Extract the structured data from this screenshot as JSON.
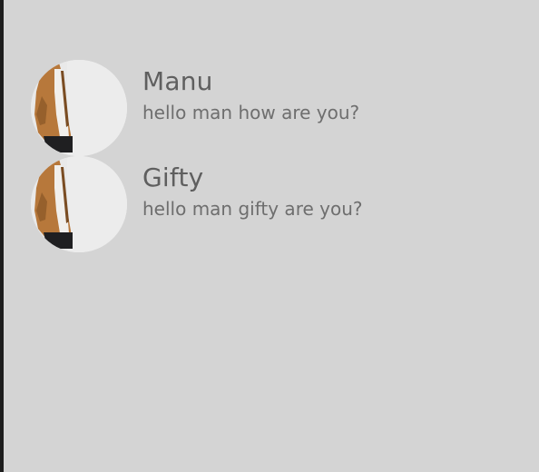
{
  "chats": [
    {
      "name": "Manu",
      "message": "hello man how are you?",
      "avatar_icon": "avatar-person-icon"
    },
    {
      "name": "Gifty",
      "message": "hello man gifty are you?",
      "avatar_icon": "avatar-person-icon"
    }
  ],
  "colors": {
    "background": "#d4d4d4",
    "name_text": "#5f5f5f",
    "message_text": "#6e6e6e",
    "avatar_background": "#e9e9e9",
    "jacket": "#b5773c"
  }
}
